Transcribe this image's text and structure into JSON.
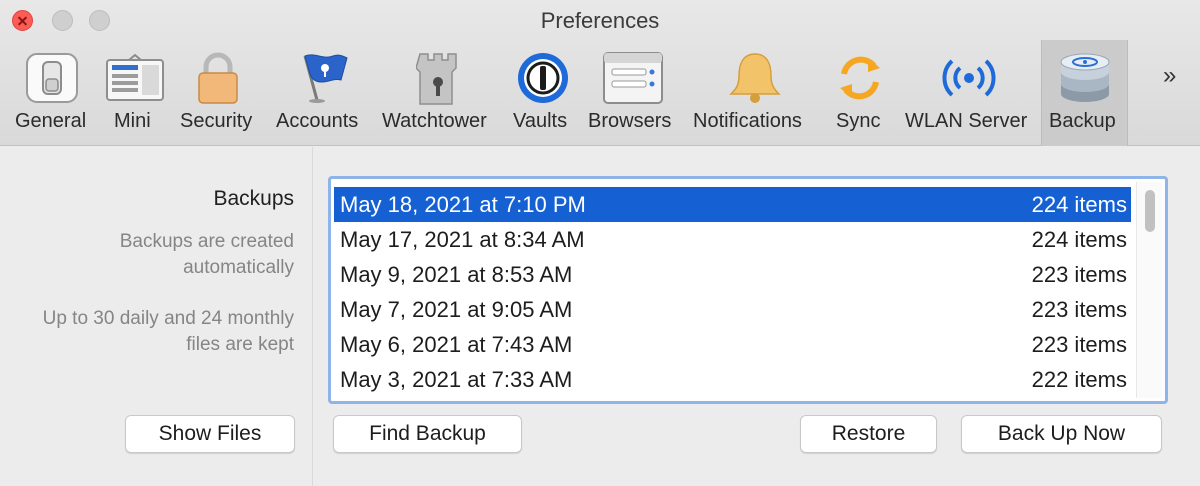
{
  "window": {
    "title": "Preferences"
  },
  "toolbar": {
    "items": [
      {
        "label": "General",
        "icon": "switch-icon"
      },
      {
        "label": "Mini",
        "icon": "mini-window-icon"
      },
      {
        "label": "Security",
        "icon": "lock-icon"
      },
      {
        "label": "Accounts",
        "icon": "flag-icon"
      },
      {
        "label": "Watchtower",
        "icon": "tower-icon"
      },
      {
        "label": "Vaults",
        "icon": "vault-icon"
      },
      {
        "label": "Browsers",
        "icon": "browser-icon"
      },
      {
        "label": "Notifications",
        "icon": "bell-icon"
      },
      {
        "label": "Sync",
        "icon": "sync-icon"
      },
      {
        "label": "WLAN Server",
        "icon": "wireless-icon"
      },
      {
        "label": "Backup",
        "icon": "database-icon"
      }
    ],
    "selected": "Backup",
    "overflow": "»"
  },
  "sidebar": {
    "heading": "Backups",
    "note1": "Backups are created automatically",
    "note2": "Up to 30 daily and 24 monthly files are kept",
    "show_files_label": "Show Files"
  },
  "backups": {
    "rows": [
      {
        "date": "May 18, 2021 at 7:10 PM",
        "count": "224 items"
      },
      {
        "date": "May 17, 2021 at 8:34 AM",
        "count": "224 items"
      },
      {
        "date": "May 9, 2021 at 8:53 AM",
        "count": "223 items"
      },
      {
        "date": "May 7, 2021 at 9:05 AM",
        "count": "223 items"
      },
      {
        "date": "May 6, 2021 at 7:43 AM",
        "count": "223 items"
      },
      {
        "date": "May 3, 2021 at 7:33 AM",
        "count": "222 items"
      }
    ],
    "selected_index": 0
  },
  "actions": {
    "find_backup": "Find Backup",
    "restore": "Restore",
    "back_up_now": "Back Up Now"
  },
  "colors": {
    "selection": "#1561d4",
    "focus_ring": "#8fb4e9",
    "close_button": "#fc5c56"
  }
}
